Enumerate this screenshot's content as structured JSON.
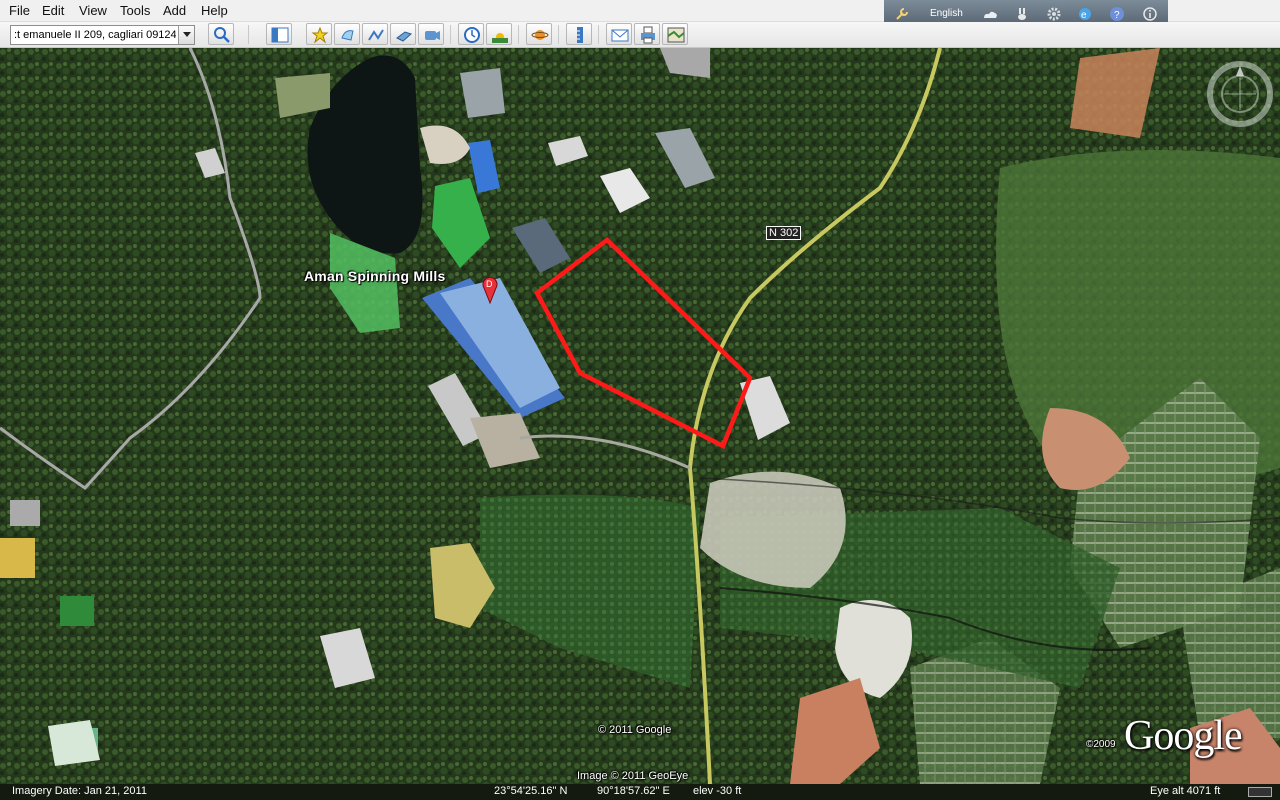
{
  "menu": {
    "file": "File",
    "edit": "Edit",
    "view": "View",
    "tools": "Tools",
    "add": "Add",
    "help": "Help"
  },
  "search": {
    "value": ":t emanuele II 209, cagliari 09124"
  },
  "toolbar_icons": [
    "search-icon",
    "sidebar-toggle-icon",
    "placemark-icon",
    "polygon-icon",
    "path-icon",
    "image-overlay-icon",
    "record-tour-icon",
    "historical-imagery-icon",
    "sunlight-icon",
    "planets-icon",
    "ruler-icon",
    "email-icon",
    "print-icon",
    "view-in-maps-icon"
  ],
  "top_panel": {
    "language": "English"
  },
  "map": {
    "place_label": "Aman Spinning Mills",
    "marker_letter": "D",
    "road_label": "N 302",
    "copyright_google": "© 2011 Google",
    "copyright_geoeye": "Image © 2011 GeoEye",
    "copyright_2009": "©2009",
    "logo": "Google"
  },
  "status": {
    "imagery_date": "Imagery Date: Jan 21, 2011",
    "lat": "23°54'25.16\" N",
    "lon": "90°18'57.62\" E",
    "elev": "elev  -30 ft",
    "eye_alt": "Eye alt    4071 ft"
  },
  "colors": {
    "highlight_polygon": "#ff1a1a",
    "marker": "#e8323a",
    "road": "#c8c860"
  }
}
